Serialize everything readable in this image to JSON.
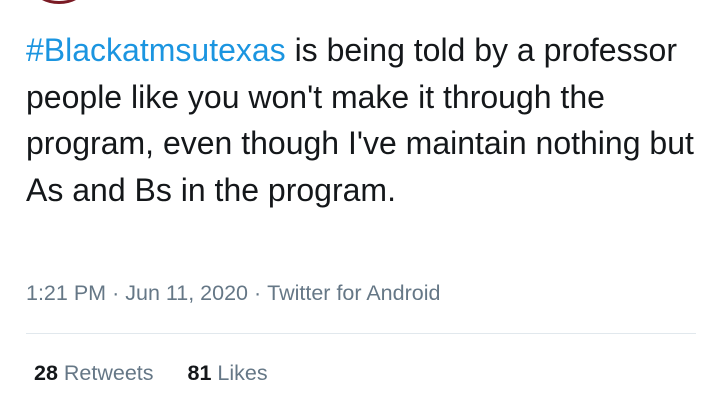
{
  "tweet": {
    "hashtag": "#Blackatmsutexas",
    "body": " is being told by a professor people like you won't make it through the program, even though I've maintain nothing but As and Bs in the program.",
    "time": "1:21 PM",
    "date": "Jun 11, 2020",
    "source": "Twitter for Android",
    "separator": "·"
  },
  "stats": {
    "retweets_count": "28",
    "retweets_label": "Retweets",
    "likes_count": "81",
    "likes_label": "Likes"
  },
  "colors": {
    "hashtag": "#1b95e0",
    "text": "#14171a",
    "secondary": "#657786",
    "divider": "#e1e8ed",
    "avatar_ring": "#7a1a24"
  }
}
